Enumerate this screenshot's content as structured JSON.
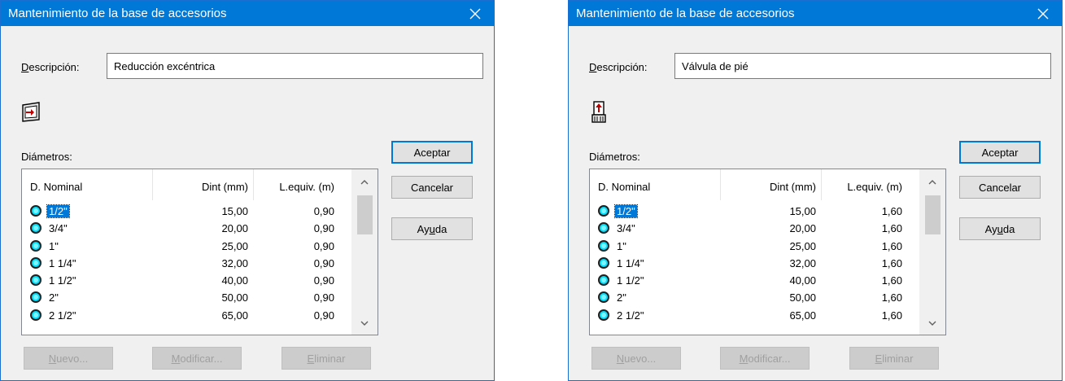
{
  "colors": {
    "titlebar": "#0078d7",
    "selection": "#0078d7",
    "fitting_dot": "#00e0ff"
  },
  "dialogs": [
    {
      "title": "Mantenimiento de la base de accesorios",
      "description_label_pre": "",
      "description_label_u": "D",
      "description_label_post": "escripción:",
      "description_value": "Reducción excéntrica",
      "fitting_icon": "eccentric-reducer-icon",
      "diametros_label": "Diámetros:",
      "columns": [
        "D. Nominal",
        "Dint (mm)",
        "L.equiv. (m)"
      ],
      "rows": [
        {
          "nominal": "1/2\"",
          "dint": "15,00",
          "lequiv": "0,90"
        },
        {
          "nominal": "3/4\"",
          "dint": "20,00",
          "lequiv": "0,90"
        },
        {
          "nominal": "1\"",
          "dint": "25,00",
          "lequiv": "0,90"
        },
        {
          "nominal": "1 1/4\"",
          "dint": "32,00",
          "lequiv": "0,90"
        },
        {
          "nominal": "1 1/2\"",
          "dint": "40,00",
          "lequiv": "0,90"
        },
        {
          "nominal": "2\"",
          "dint": "50,00",
          "lequiv": "0,90"
        },
        {
          "nominal": "2 1/2\"",
          "dint": "65,00",
          "lequiv": "0,90"
        }
      ],
      "buttons": {
        "accept": "Aceptar",
        "cancel": "Cancelar",
        "help_pre": "Ay",
        "help_u": "u",
        "help_post": "da",
        "new_pre": "",
        "new_u": "N",
        "new_post": "uevo...",
        "modify_pre": "",
        "modify_u": "M",
        "modify_post": "odificar...",
        "delete_pre": "",
        "delete_u": "E",
        "delete_post": "liminar"
      }
    },
    {
      "title": "Mantenimiento de la base de accesorios",
      "description_label_pre": "",
      "description_label_u": "D",
      "description_label_post": "escripción:",
      "description_value": "Válvula de pié",
      "fitting_icon": "foot-valve-icon",
      "diametros_label": "Diámetros:",
      "columns": [
        "D. Nominal",
        "Dint (mm)",
        "L.equiv. (m)"
      ],
      "rows": [
        {
          "nominal": "1/2\"",
          "dint": "15,00",
          "lequiv": "1,60"
        },
        {
          "nominal": "3/4\"",
          "dint": "20,00",
          "lequiv": "1,60"
        },
        {
          "nominal": "1\"",
          "dint": "25,00",
          "lequiv": "1,60"
        },
        {
          "nominal": "1 1/4\"",
          "dint": "32,00",
          "lequiv": "1,60"
        },
        {
          "nominal": "1 1/2\"",
          "dint": "40,00",
          "lequiv": "1,60"
        },
        {
          "nominal": "2\"",
          "dint": "50,00",
          "lequiv": "1,60"
        },
        {
          "nominal": "2 1/2\"",
          "dint": "65,00",
          "lequiv": "1,60"
        }
      ],
      "buttons": {
        "accept": "Aceptar",
        "cancel": "Cancelar",
        "help_pre": "Ay",
        "help_u": "u",
        "help_post": "da",
        "new_pre": "",
        "new_u": "N",
        "new_post": "uevo...",
        "modify_pre": "",
        "modify_u": "M",
        "modify_post": "odificar...",
        "delete_pre": "",
        "delete_u": "E",
        "delete_post": "liminar"
      }
    }
  ]
}
